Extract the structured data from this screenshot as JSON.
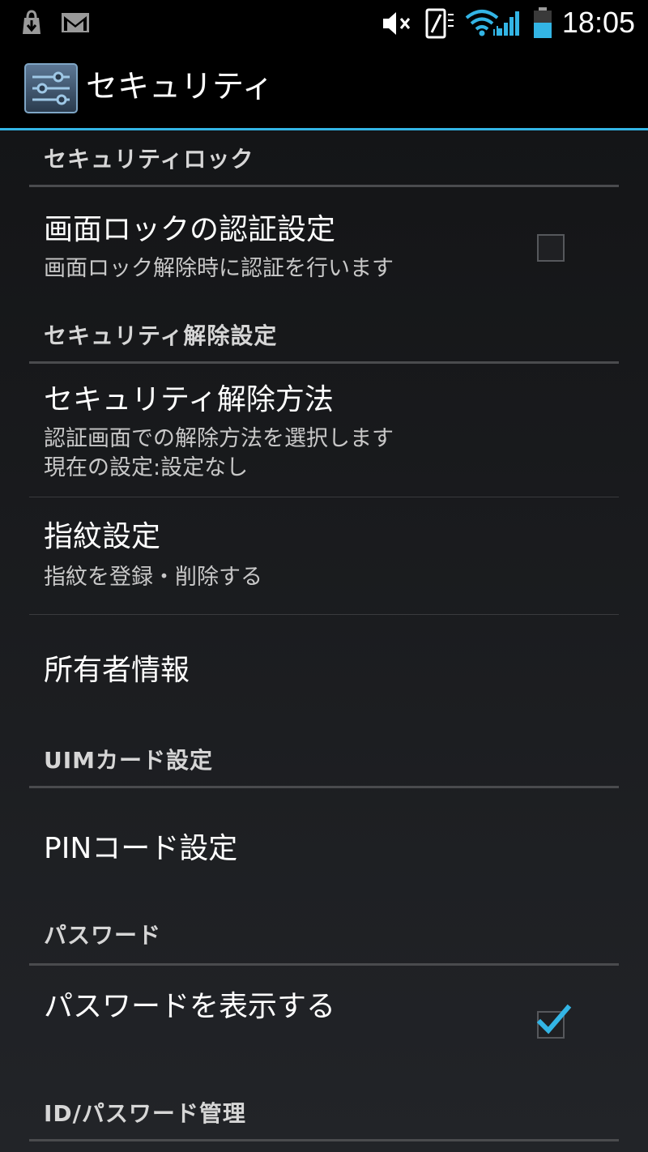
{
  "status_bar": {
    "time": "18:05",
    "icons": [
      "download-icon",
      "gmail-icon",
      "mute-icon",
      "vibrate-icon",
      "wifi-icon",
      "signal-icon",
      "battery-icon"
    ]
  },
  "action_bar": {
    "title": "セキュリティ",
    "icon": "settings-sliders-icon"
  },
  "sections": {
    "security_lock": {
      "header": "セキュリティロック",
      "screen_lock_auth": {
        "title": "画面ロックの認証設定",
        "summary": "画面ロック解除時に認証を行います",
        "checked": false
      }
    },
    "security_unlock": {
      "header": "セキュリティ解除設定",
      "unlock_method": {
        "title": "セキュリティ解除方法",
        "summary_line1": "認証画面での解除方法を選択します",
        "summary_line2": "現在の設定:設定なし"
      },
      "fingerprint": {
        "title": "指紋設定",
        "summary": "指紋を登録・削除する"
      },
      "owner_info": {
        "title": "所有者情報"
      }
    },
    "uim_card": {
      "header": "UIMカード設定",
      "pin_code": {
        "title": "PINコード設定"
      }
    },
    "password": {
      "header": "パスワード",
      "show_password": {
        "title": "パスワードを表示する",
        "checked": true
      }
    },
    "id_password": {
      "header": "ID/パスワード管理"
    }
  },
  "colors": {
    "accent": "#33b5e5",
    "background": "#1d1e21",
    "status_bar": "#000000"
  }
}
